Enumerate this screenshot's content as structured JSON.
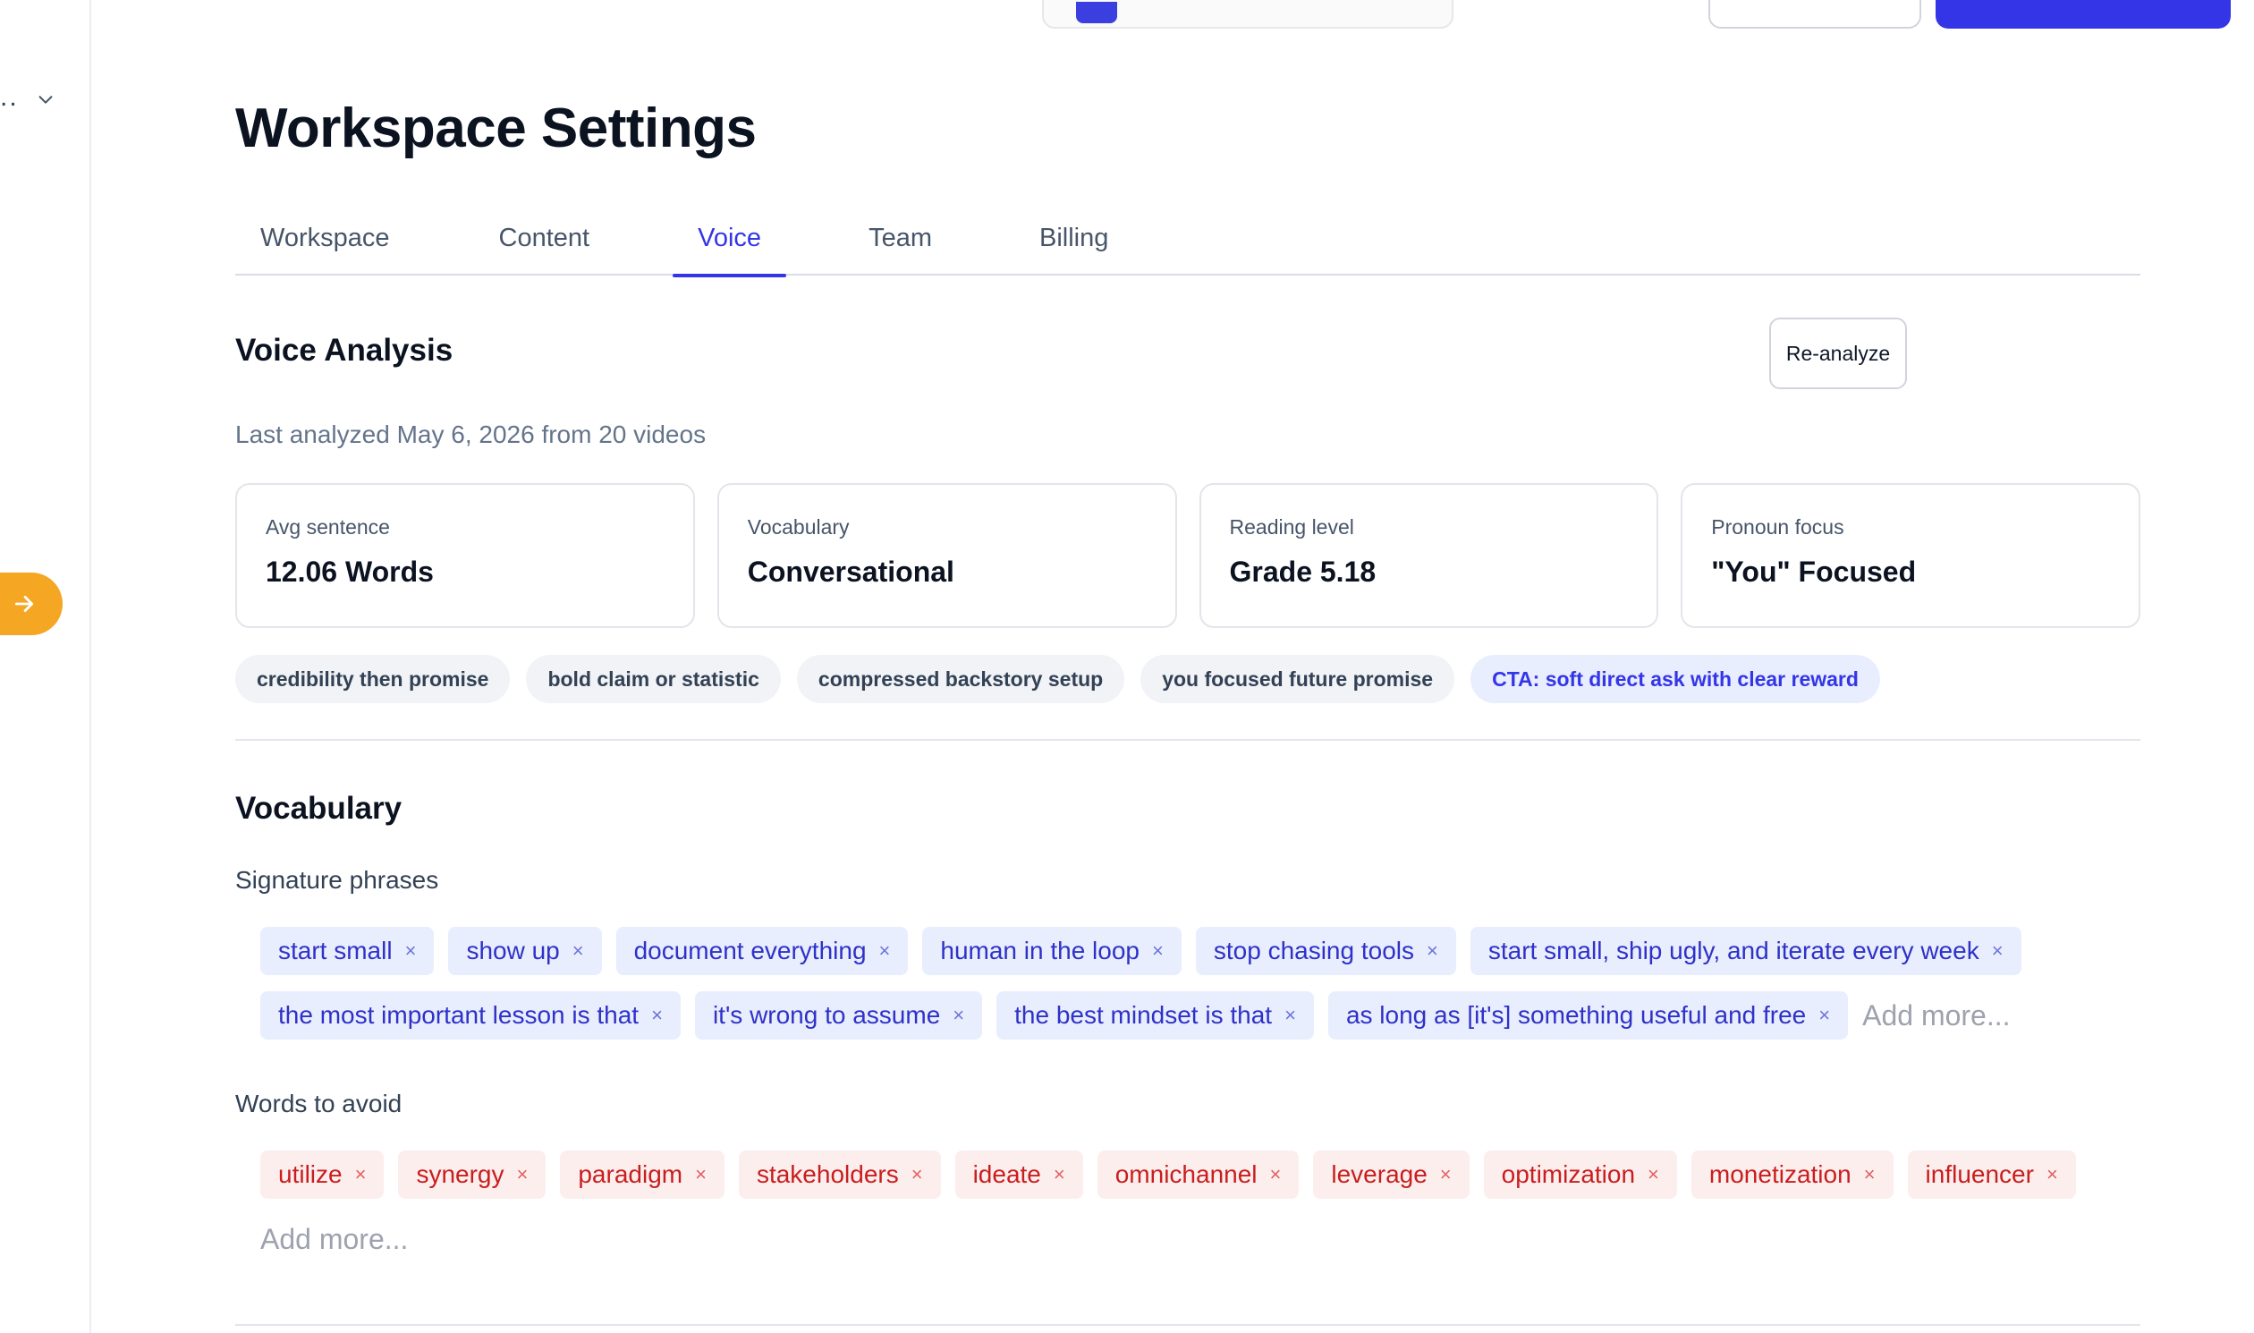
{
  "sidebar": {
    "ellipsis": "..",
    "fab_icon": "arrow-right-icon"
  },
  "page": {
    "title": "Workspace Settings"
  },
  "tabs": [
    {
      "label": "Workspace"
    },
    {
      "label": "Content"
    },
    {
      "label": "Voice",
      "active": true
    },
    {
      "label": "Team"
    },
    {
      "label": "Billing"
    }
  ],
  "voice_analysis": {
    "title": "Voice Analysis",
    "reanalyze_label": "Re-analyze",
    "last_analyzed": "Last analyzed May 6, 2026 from 20 videos",
    "metrics": [
      {
        "label": "Avg sentence",
        "value": "12.06 Words"
      },
      {
        "label": "Vocabulary",
        "value": "Conversational"
      },
      {
        "label": "Reading level",
        "value": "Grade 5.18"
      },
      {
        "label": "Pronoun focus",
        "value": "\"You\" Focused"
      }
    ],
    "patterns": [
      "credibility then promise",
      "bold claim or statistic",
      "compressed backstory setup",
      "you focused future promise",
      "CTA: soft direct ask with clear reward"
    ]
  },
  "vocabulary": {
    "title": "Vocabulary",
    "signature_label": "Signature phrases",
    "signature_phrases": [
      "start small",
      "show up",
      "document everything",
      "human in the loop",
      "stop chasing tools",
      "start small, ship ugly, and iterate every week",
      "the most important lesson is that",
      "it's wrong to assume",
      "the best mindset is that",
      "as long as [it's] something useful and free"
    ],
    "avoid_label": "Words to avoid",
    "words_to_avoid": [
      "utilize",
      "synergy",
      "paradigm",
      "stakeholders",
      "ideate",
      "omnichannel",
      "leverage",
      "optimization",
      "monetization",
      "influencer"
    ],
    "add_more_placeholder": "Add more...",
    "remove_glyph": "×"
  },
  "colors": {
    "accent": "#3535e8",
    "fab": "#f5a623",
    "avoid_text": "#c81e1e"
  }
}
